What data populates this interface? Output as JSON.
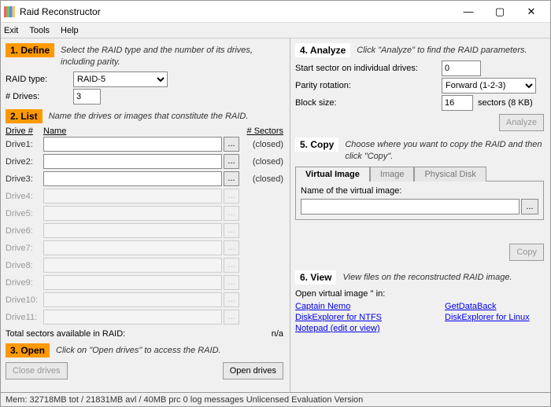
{
  "window": {
    "title": "Raid Reconstructor"
  },
  "menu": {
    "exit": "Exit",
    "tools": "Tools",
    "help": "Help"
  },
  "define": {
    "badge": "1. Define",
    "desc": "Select the RAID type and the number of its drives, including parity.",
    "raidtype_label": "RAID type:",
    "raidtype_value": "RAID-5",
    "drives_label": "# Drives:",
    "drives_value": "3"
  },
  "list": {
    "badge": "2. List",
    "desc": "Name the drives or images that constitute the RAID.",
    "col_drive": "Drive #",
    "col_name": "Name",
    "col_sectors": "# Sectors",
    "rows": [
      {
        "label": "Drive1:",
        "enabled": true,
        "status": "(closed)"
      },
      {
        "label": "Drive2:",
        "enabled": true,
        "status": "(closed)"
      },
      {
        "label": "Drive3:",
        "enabled": true,
        "status": "(closed)"
      },
      {
        "label": "Drive4:",
        "enabled": false,
        "status": ""
      },
      {
        "label": "Drive5:",
        "enabled": false,
        "status": ""
      },
      {
        "label": "Drive6:",
        "enabled": false,
        "status": ""
      },
      {
        "label": "Drive7:",
        "enabled": false,
        "status": ""
      },
      {
        "label": "Drive8:",
        "enabled": false,
        "status": ""
      },
      {
        "label": "Drive9:",
        "enabled": false,
        "status": ""
      },
      {
        "label": "Drive10:",
        "enabled": false,
        "status": ""
      },
      {
        "label": "Drive11:",
        "enabled": false,
        "status": ""
      }
    ],
    "total_label": "Total sectors available in RAID:",
    "total_value": "n/a"
  },
  "open": {
    "badge": "3. Open",
    "desc": "Click on \"Open drives\" to access the RAID.",
    "close_btn": "Close drives",
    "open_btn": "Open drives"
  },
  "analyze": {
    "badge": "4. Analyze",
    "desc": "Click \"Analyze\" to find the RAID parameters.",
    "start_label": "Start sector on individual drives:",
    "start_value": "0",
    "parity_label": "Parity rotation:",
    "parity_value": "Forward (1-2-3)",
    "block_label": "Block size:",
    "block_value": "16",
    "block_suffix": "sectors (8 KB)",
    "analyze_btn": "Analyze"
  },
  "copy": {
    "badge": "5. Copy",
    "desc": "Choose where you want to copy the RAID and then click \"Copy\".",
    "tab_virtual": "Virtual Image",
    "tab_image": "Image",
    "tab_physical": "Physical Disk",
    "name_label": "Name of the virtual image:",
    "browse": "...",
    "copy_btn": "Copy"
  },
  "view": {
    "badge": "6. View",
    "desc": "View files on the reconstructed RAID image.",
    "open_text": "Open virtual image '' in:",
    "links": {
      "nemo": "Captain Nemo",
      "ntfs": "DiskExplorer for NTFS",
      "notepad": "Notepad (edit or view)",
      "gdb": "GetDataBack",
      "linux": "DiskExplorer for Linux"
    }
  },
  "status": "Mem: 32718MB tot / 21831MB avl / 40MB prc  0 log messages  Unlicensed Evaluation Version"
}
